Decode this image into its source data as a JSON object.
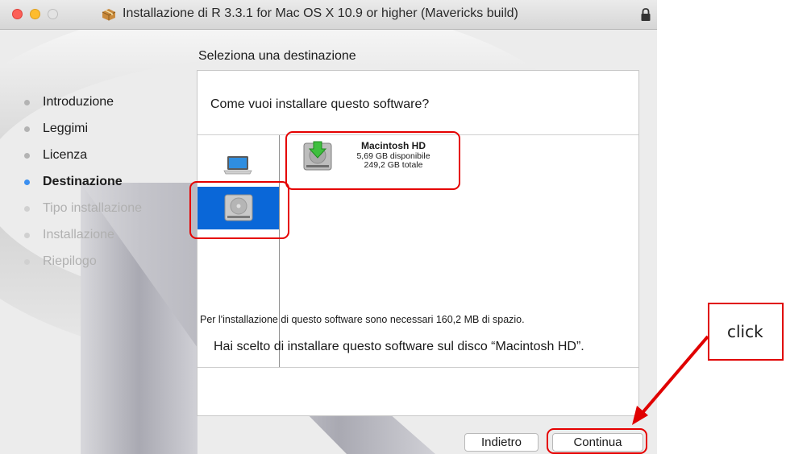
{
  "window": {
    "title": "Installazione di R 3.3.1 for Mac OS X 10.9 or higher (Mavericks build)",
    "section_title": "Seleziona una destinazione"
  },
  "sidebar": {
    "steps": [
      {
        "label": "Introduzione",
        "state": "done"
      },
      {
        "label": "Leggimi",
        "state": "done"
      },
      {
        "label": "Licenza",
        "state": "done"
      },
      {
        "label": "Destinazione",
        "state": "current"
      },
      {
        "label": "Tipo installazione",
        "state": "future"
      },
      {
        "label": "Installazione",
        "state": "future"
      },
      {
        "label": "Riepilogo",
        "state": "future"
      }
    ]
  },
  "content": {
    "question": "Come vuoi installare questo software?",
    "options_icons": [
      "laptop-icon",
      "hard-disk-icon"
    ],
    "disk": {
      "name": "Macintosh HD",
      "free": "5,69 GB disponibile",
      "total": "249,2 GB totale"
    },
    "space_note": "Per l'installazione di questo software sono necessari 160,2 MB di spazio.",
    "chosen_note": "Hai scelto di installare questo software sul disco “Macintosh HD”."
  },
  "buttons": {
    "back": "Indietro",
    "continue": "Continua"
  },
  "annotation": {
    "callout": "click",
    "color": "#e50000"
  },
  "colors": {
    "accent": "#0a67d8",
    "current_step_dot": "#3b8ff0"
  }
}
